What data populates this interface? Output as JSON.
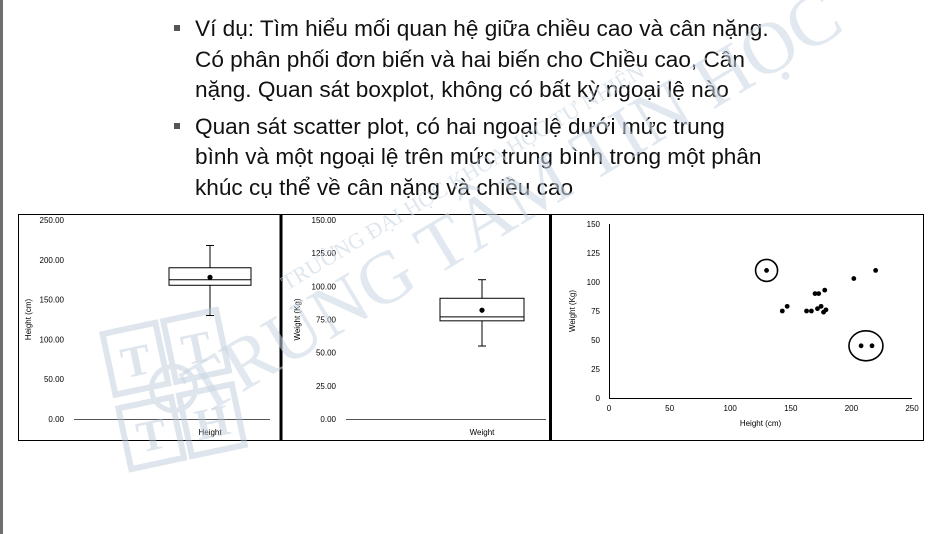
{
  "bullets": [
    "Ví dụ: Tìm hiểu mối quan hệ giữa chiều cao và cân nặng. Có phân phối đơn biến và hai biến cho Chiều cao, Cân nặng. Quan sát boxplot, không có bất kỳ ngoại lệ nào",
    "Quan sát scatter plot, có hai ngoại lệ dưới mức trung bình và một ngoại lệ trên mức trung bình trong một phân khúc cụ thể về cân nặng và chiều cao"
  ],
  "bullet_lines": [
    [
      "Ví dụ: Tìm hiểu mối quan hệ giữa chiều cao và cân nặng.",
      "Có phân phối đơn biến và hai biến cho Chiều cao, Cân",
      "nặng. Quan sát boxplot, không có bất kỳ ngoại lệ nào"
    ],
    [
      "Quan sát scatter plot, có hai ngoại lệ dưới mức trung",
      "bình và một ngoại lệ trên mức trung bình trong một phân",
      "khúc cụ thể về cân nặng và chiều cao"
    ]
  ],
  "watermark": {
    "big": "TRUNG TÂM TIN HỌC",
    "small": "TRƯỜNG ĐẠI HỌC KHOA HỌC TỰ NHIÊN",
    "logo_letters": "TT TH"
  },
  "colors": {
    "text": "#111111",
    "chart_line": "#000000",
    "watermark": "#c9d6e3",
    "bullet_marker": "#555555"
  },
  "chart_data": [
    {
      "type": "boxplot",
      "xlabel": "Height",
      "ylabel": "Height (cm)",
      "ylim": [
        0,
        250
      ],
      "yticks": [
        "0.00",
        "50.00",
        "100.00",
        "150.00",
        "200.00",
        "250.00"
      ],
      "min": 130,
      "q1": 168,
      "median": 175,
      "q3": 190,
      "max": 218,
      "mean": 178
    },
    {
      "type": "boxplot",
      "xlabel": "Weight",
      "ylabel": "Weight (Kg)",
      "ylim": [
        0,
        150
      ],
      "yticks": [
        "0.00",
        "25.00",
        "50.00",
        "75.00",
        "100.00",
        "125.00",
        "150.00"
      ],
      "min": 55,
      "q1": 74,
      "median": 77,
      "q3": 91,
      "max": 105,
      "mean": 82
    },
    {
      "type": "scatter",
      "xlabel": "Height (cm)",
      "ylabel": "Weight (Kg)",
      "xlim": [
        0,
        250
      ],
      "ylim": [
        0,
        150
      ],
      "xticks": [
        "0",
        "50",
        "100",
        "150",
        "200",
        "250"
      ],
      "yticks": [
        "0",
        "25",
        "50",
        "75",
        "100",
        "125",
        "150"
      ],
      "points": [
        [
          130,
          110
        ],
        [
          143,
          75
        ],
        [
          147,
          79
        ],
        [
          163,
          75
        ],
        [
          167,
          75
        ],
        [
          170,
          90
        ],
        [
          173,
          90
        ],
        [
          172,
          77
        ],
        [
          175,
          79
        ],
        [
          178,
          93
        ],
        [
          179,
          76
        ],
        [
          177,
          74
        ],
        [
          202,
          103
        ],
        [
          220,
          110
        ],
        [
          208,
          45
        ],
        [
          217,
          45
        ]
      ],
      "circled_outliers": [
        [
          130,
          110
        ],
        [
          212,
          45
        ]
      ]
    }
  ]
}
